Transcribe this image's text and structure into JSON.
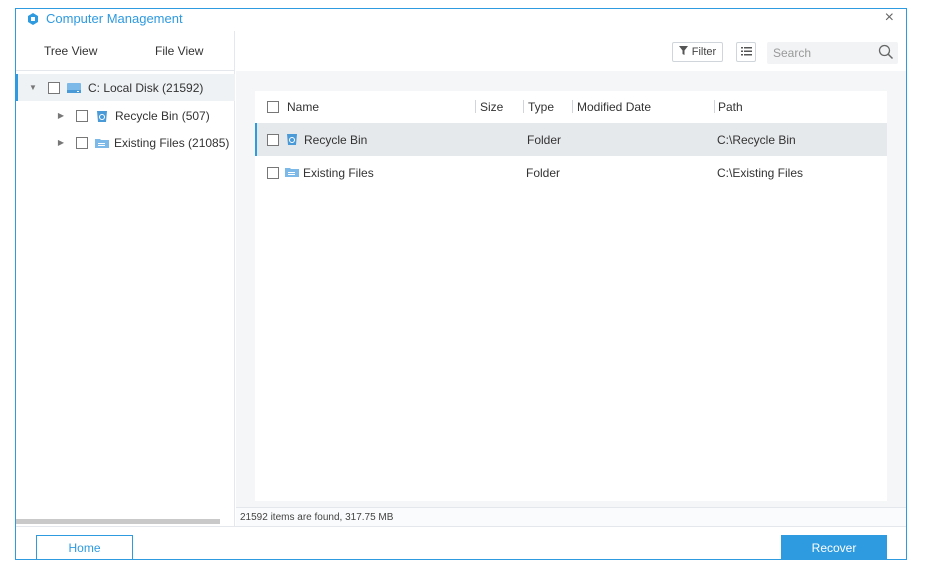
{
  "window": {
    "title": "Computer Management",
    "close_glyph": "×",
    "accent": "#2e9ae0"
  },
  "view_tabs": [
    {
      "label": "Tree View"
    },
    {
      "label": "File View"
    }
  ],
  "tree": [
    {
      "label": "C: Local Disk (21592)",
      "icon": "drive-icon",
      "expanded": true,
      "selected": true
    },
    {
      "label": "Recycle Bin (507)",
      "icon": "recycle-bin-icon",
      "expanded": false
    },
    {
      "label": "Existing Files (21085)",
      "icon": "folder-icon",
      "expanded": false
    }
  ],
  "toolbar": {
    "filter_label": "Filter",
    "search_placeholder": "Search"
  },
  "grid": {
    "columns": [
      "Name",
      "Size",
      "Type",
      "Modified Date",
      "Path"
    ],
    "rows": [
      {
        "name": "Recycle Bin",
        "icon": "recycle-bin-icon",
        "size": "",
        "type": "Folder",
        "modified": "",
        "path": "C:\\Recycle Bin",
        "selected": true
      },
      {
        "name": "Existing Files",
        "icon": "folder-icon",
        "size": "",
        "type": "Folder",
        "modified": "",
        "path": "C:\\Existing Files",
        "selected": false
      }
    ]
  },
  "status_text": "21592 items are found, 317.75 MB",
  "footer": {
    "home_label": "Home",
    "recover_label": "Recover"
  }
}
